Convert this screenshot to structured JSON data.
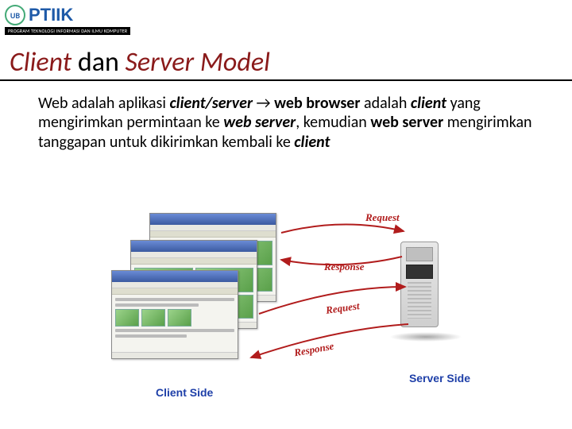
{
  "logo": {
    "mark": "UB",
    "text": "PTIIK",
    "tagline": "PROGRAM TEKNOLOGI INFORMASI DAN ILMU KOMPUTER"
  },
  "title": {
    "part1": "Client",
    "part2": " dan ",
    "part3": "Server Model"
  },
  "body": {
    "t1": "Web adalah aplikasi ",
    "t2": "client/server",
    "t3": " → ",
    "t4": "web browser",
    "t5": " adalah ",
    "t6": "client",
    "t7": " yang mengirimkan permintaan ke ",
    "t8": "web server",
    "t9": ", kemudian ",
    "t10": "web server",
    "t11": " mengirimkan tanggapan untuk dikirimkan kembali ke ",
    "t12": "client"
  },
  "diagram": {
    "client_label": "Client Side",
    "server_label": "Server Side",
    "req1": "Request",
    "resp1": "Response",
    "req2": "Request",
    "resp2": "Response"
  }
}
